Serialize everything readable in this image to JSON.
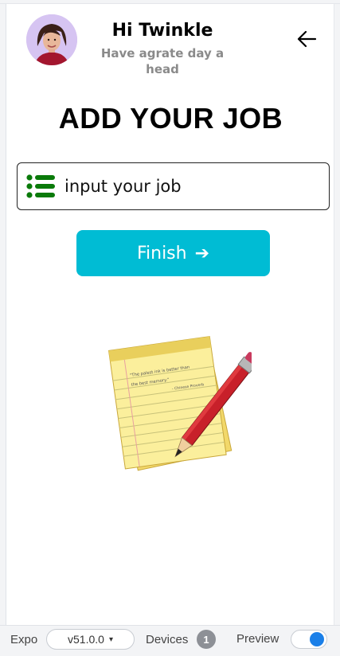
{
  "header": {
    "greeting": "Hi Twinkle",
    "subtitle": "Have agrate day a head",
    "avatar_icon": "user-avatar",
    "back_icon": "arrow-left-icon"
  },
  "main": {
    "title": "ADD YOUR JOB",
    "job_input": {
      "value": "",
      "placeholder": "input your job",
      "icon": "list-icon"
    },
    "finish_button": {
      "label": "Finish",
      "arrow": "➔",
      "color": "#00bcd4"
    },
    "illustration": "notepad-pencil-icon",
    "notepad_text": {
      "quote_line1": "\"The palest ink is better than",
      "quote_line2": "the best memory.\"",
      "attribution": "- Chinese Proverb"
    }
  },
  "bottom_bar": {
    "expo_label": "Expo",
    "version": "v51.0.0",
    "version_chevron": "▾",
    "devices_label": "Devices",
    "devices_count": "1",
    "preview_label": "Preview",
    "preview_enabled": true,
    "toggle_color": "#1a7fe8"
  },
  "colors": {
    "accent": "#00bcd4",
    "list_icon": "#0a7a0a",
    "subtitle": "#8a8a8a"
  }
}
